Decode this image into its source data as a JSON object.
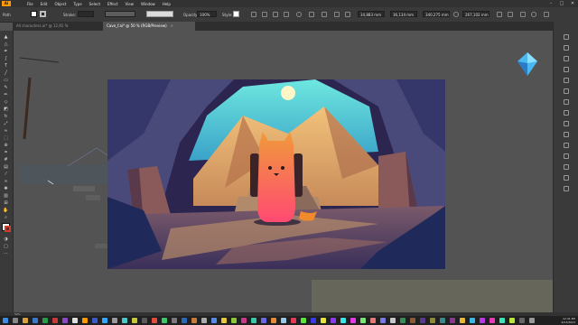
{
  "app": {
    "logo": "Ai"
  },
  "menu": [
    "File",
    "Edit",
    "Object",
    "Type",
    "Select",
    "Effect",
    "View",
    "Window",
    "Help"
  ],
  "control_bar": {
    "selection_label": "Path",
    "stroke_label": "Stroke:",
    "opacity_label": "Opacity:",
    "opacity_value": "100%",
    "style_label": "Style:",
    "x_value": "34,883 mm",
    "y_value": "36,134 mm",
    "w_value": "340,275 mm",
    "h_value": "267,102 mm"
  },
  "tabs": [
    {
      "label": "All characters.ai* @ 12,91 % (RGB/Preview)",
      "active": false
    },
    {
      "label": "Cave_f.ai* @ 50 % (RGB/Preview)",
      "active": true
    }
  ],
  "statusbar": {
    "zoom": "50%"
  },
  "clock": {
    "time": "12:41 PM",
    "date": "6/13/2023"
  },
  "colors": {
    "app_bg": "#535353",
    "panel_bg": "#3a3a3a",
    "menubar_bg": "#323232",
    "accent_orange": "#ff9a00",
    "fox_top": "#f08a3a",
    "fox_bottom": "#ff4a6e",
    "sky": "#4fd0dc"
  }
}
